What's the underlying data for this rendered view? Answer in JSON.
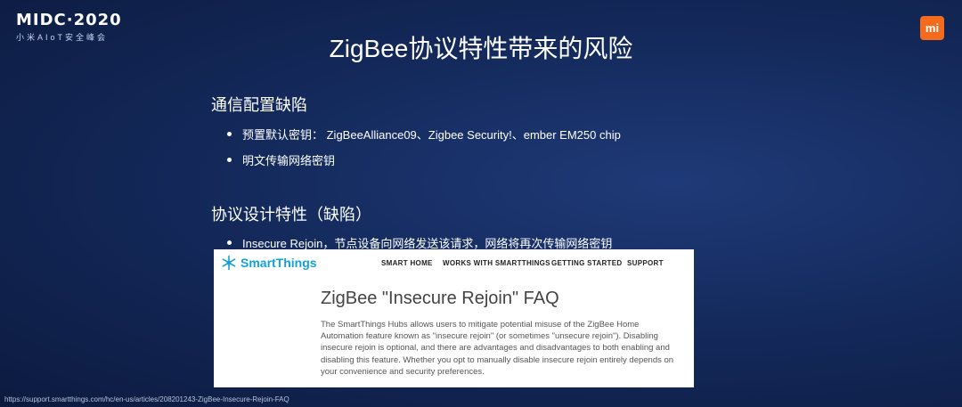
{
  "logo": {
    "main": "MIDC·2020",
    "sub": "小米AIoT安全峰会"
  },
  "badge": {
    "text": "mi",
    "color": "#f46b1e"
  },
  "slide": {
    "title": "ZigBee协议特性带来的风险",
    "sections": [
      {
        "heading": "通信配置缺陷",
        "bullets": [
          "预置默认密钥： ZigBeeAlliance09、Zigbee Security!、ember EM250 chip",
          "明文传输网络密钥"
        ]
      },
      {
        "heading": "协议设计特性（缺陷）",
        "bullets": [
          "Insecure Rejoin，节点设备向网络发送该请求，网络将再次传输网络密钥"
        ]
      }
    ]
  },
  "inset": {
    "brand": "SmartThings",
    "brand_color": "#15a0dc",
    "nav": [
      "SMART HOME",
      "WORKS WITH SMARTTHINGS",
      "GETTING STARTED",
      "SUPPORT"
    ],
    "title": "ZigBee \"Insecure Rejoin\" FAQ",
    "body": "The SmartThings Hubs allows users to mitigate potential misuse of the ZigBee Home Automation feature known as \"insecure rejoin\" (or sometimes \"unsecure rejoin\"). Disabling insecure rejoin is optional, and there are advantages and disadvantages to both enabling and disabling this feature. Whether you opt to manually disable insecure rejoin entirely depends on your convenience and security preferences."
  },
  "source_url": "https://support.smartthings.com/hc/en-us/articles/208201243-ZigBee-Insecure-Rejoin-FAQ"
}
